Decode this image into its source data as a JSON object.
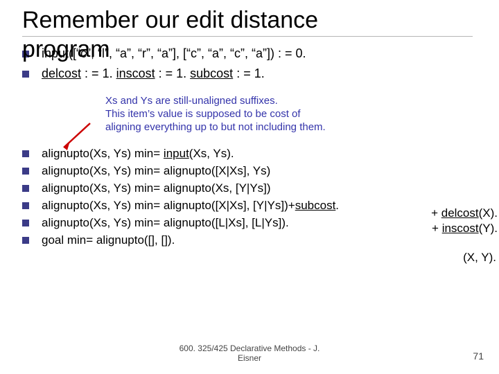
{
  "title_top": "Remember our edit distance",
  "title_overlay": "program",
  "line1": "input([“c”, “l”, “a”, “r”, “a”],  [“c”, “a”, “c”, “a”]) : = 0.",
  "line2_a": "delcost",
  "line2_b": " : = 1.   ",
  "line2_c": "inscost",
  "line2_d": " : = 1.   ",
  "line2_e": "subcost",
  "line2_f": " : = 1.",
  "note_l1": "Xs and Ys are still-unaligned suffixes.",
  "note_l2": "This item’s value is supposed to be cost of",
  "note_l3": "aligning everything up to but not including them.",
  "rules": [
    {
      "lhs": "alignupto(Xs, Ys) min= ",
      "mid": "input",
      "rhs": "(Xs, Ys)."
    },
    {
      "lhs": "alignupto(Xs, Ys) min= alignupto([X|Xs], Ys)",
      "mid": "",
      "rhs": ""
    },
    {
      "lhs": "alignupto(Xs, Ys) min= alignupto(Xs, [Y|Ys])",
      "mid": "",
      "rhs": ""
    },
    {
      "lhs": "alignupto(Xs, Ys) min= alignupto([X|Xs], [Y|Ys])+",
      "mid": "subcost",
      "rhs": "."
    },
    {
      "lhs": "alignupto(Xs, Ys) min= alignupto([L|Xs], [L|Ys]).",
      "mid": "",
      "rhs": ""
    },
    {
      "lhs": "goal min= alignupto([], []).",
      "mid": "",
      "rhs": ""
    }
  ],
  "plus_del_a": "+ ",
  "plus_del_b": "delcost",
  "plus_del_c": "(X).",
  "plus_ins_a": "+ ",
  "plus_ins_b": "inscost",
  "plus_ins_c": "(Y).",
  "plus_sub_xy": "(X, Y).",
  "footer_l1": "600. 325/425 Declarative Methods - J.",
  "footer_l2": "Eisner",
  "page": "71"
}
